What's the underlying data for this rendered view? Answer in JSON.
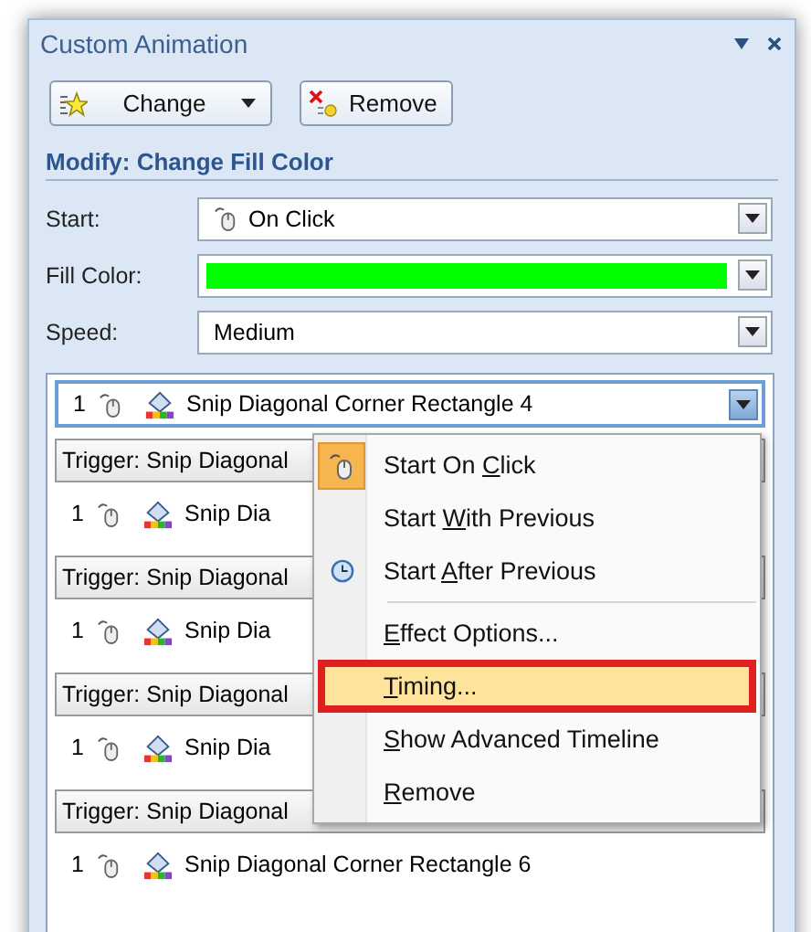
{
  "pane": {
    "title": "Custom Animation",
    "buttons": [
      {
        "kind": "change",
        "label": "Change"
      },
      {
        "kind": "remove",
        "label": "Remove"
      }
    ],
    "section_title": "Modify: Change Fill Color",
    "fields": [
      {
        "kind": "start",
        "label": "Start:",
        "value": "On Click"
      },
      {
        "kind": "color",
        "label": "Fill Color:",
        "color": "#00ff00"
      },
      {
        "kind": "text",
        "label": "Speed:",
        "value": "Medium"
      }
    ],
    "list": [
      {
        "kind": "effect",
        "number": "1",
        "name": "Snip Diagonal Corner Rectangle 4",
        "selected": true
      },
      {
        "kind": "trigger",
        "label": "Trigger: Snip Diagonal"
      },
      {
        "kind": "effect",
        "number": "1",
        "name": "Snip Dia",
        "selected": false
      },
      {
        "kind": "trigger",
        "label": "Trigger: Snip Diagonal"
      },
      {
        "kind": "effect",
        "number": "1",
        "name": "Snip Dia",
        "selected": false
      },
      {
        "kind": "trigger",
        "label": "Trigger: Snip Diagonal"
      },
      {
        "kind": "effect",
        "number": "1",
        "name": "Snip Dia",
        "selected": false
      },
      {
        "kind": "trigger",
        "label": "Trigger: Snip Diagonal"
      },
      {
        "kind": "effect",
        "number": "1",
        "name": "Snip Diagonal Corner Rectangle 6",
        "selected": false
      }
    ]
  },
  "context_menu": {
    "items": [
      {
        "kind": "mouse_item",
        "pre": "Start On ",
        "key": "C",
        "post": "lick",
        "checked": true,
        "selected": false
      },
      {
        "kind": "item",
        "pre": "Start ",
        "key": "W",
        "post": "ith Previous",
        "checked": false,
        "selected": false
      },
      {
        "kind": "clock_item",
        "pre": "Start ",
        "key": "A",
        "post": "fter Previous",
        "checked": false,
        "selected": false
      },
      {
        "kind": "separator"
      },
      {
        "kind": "item",
        "key": "E",
        "post": "ffect Options...",
        "checked": false,
        "selected": false
      },
      {
        "kind": "item",
        "key": "T",
        "post": "iming...",
        "checked": false,
        "selected": true
      },
      {
        "kind": "item",
        "key": "S",
        "post": "how Advanced Timeline",
        "checked": false,
        "selected": false
      },
      {
        "kind": "item",
        "key": "R",
        "post": "emove",
        "checked": false,
        "selected": false
      }
    ]
  }
}
